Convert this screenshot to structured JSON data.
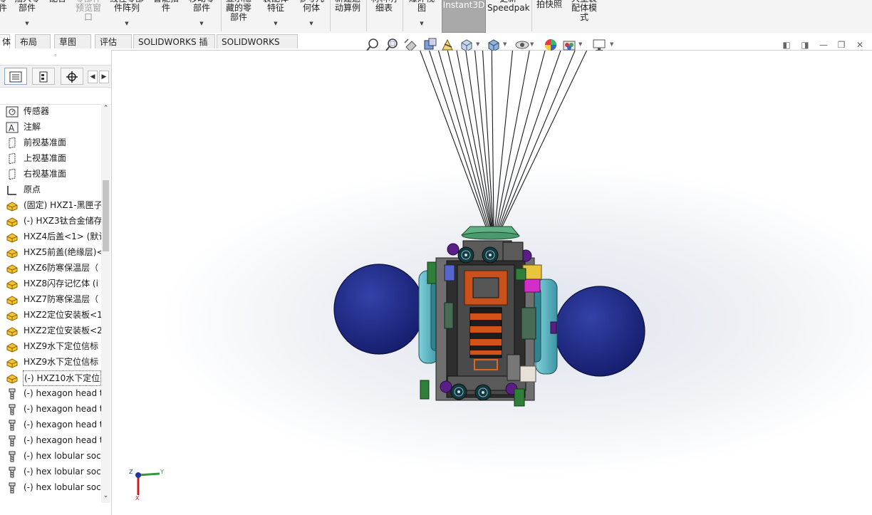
{
  "ribbon": {
    "buttons": [
      {
        "id": "rb-a",
        "label": "零\n件",
        "icon": "part-icon"
      },
      {
        "id": "rb-b",
        "label": "插入零\n部件",
        "icon": "insert-component-icon"
      },
      {
        "id": "rb-c",
        "label": "配合",
        "icon": "mate-icon"
      },
      {
        "id": "rb-d",
        "label": "零部件\n预览窗\n口",
        "icon": "preview-icon"
      },
      {
        "id": "rb-e",
        "label": "线性零部\n件阵列",
        "icon": "pattern-icon"
      },
      {
        "id": "rb-f",
        "label": "智能扣\n件",
        "icon": "smart-fastener-icon"
      },
      {
        "id": "rb-g",
        "label": "移动零\n部件",
        "icon": "move-component-icon"
      },
      {
        "id": "rb-h",
        "label": "显示隐\n藏的零\n部件",
        "icon": "show-hidden-icon"
      },
      {
        "id": "rb-i",
        "label": "装配体\n特征",
        "icon": "assembly-feature-icon"
      },
      {
        "id": "rb-j",
        "label": "参考几\n何体",
        "icon": "reference-geometry-icon"
      },
      {
        "id": "rb-k",
        "label": "新建运\n动算例",
        "icon": "motion-study-icon"
      },
      {
        "id": "rb-l",
        "label": "材料明\n细表",
        "icon": "bom-icon"
      },
      {
        "id": "rb-m",
        "label": "爆炸视\n图",
        "icon": "exploded-view-icon"
      },
      {
        "id": "rb-n",
        "label": "Instant3D",
        "icon": "instant3d-icon"
      },
      {
        "id": "rb-o",
        "label": "更新\nSpeedpak",
        "icon": "speedpak-icon"
      },
      {
        "id": "rb-p",
        "label": "拍快照",
        "icon": "snapshot-icon"
      },
      {
        "id": "rb-q",
        "label": "大型装\n配体模\n式",
        "icon": "large-assembly-icon"
      }
    ]
  },
  "tabs": [
    "体",
    "布局",
    "草图",
    "评估",
    "SOLIDWORKS 插件",
    "SOLIDWORKS MBD"
  ],
  "panel": {
    "grip": "◦",
    "tree": [
      {
        "label": "传感器",
        "icon": "sensor-icon"
      },
      {
        "label": "注解",
        "icon": "annotation-icon"
      },
      {
        "label": "前视基准面",
        "icon": "plane-icon"
      },
      {
        "label": "上视基准面",
        "icon": "plane-icon"
      },
      {
        "label": "右视基准面",
        "icon": "plane-icon"
      },
      {
        "label": "原点",
        "icon": "origin-icon"
      },
      {
        "label": "(固定) HXZ1-黑匣子",
        "icon": "part-icon"
      },
      {
        "label": "(-) HXZ3钛合金储存",
        "icon": "part-icon"
      },
      {
        "label": "HXZ4后盖<1> (默认",
        "icon": "part-icon"
      },
      {
        "label": "HXZ5前盖(绝缘层)<",
        "icon": "part-icon"
      },
      {
        "label": "HXZ6防寒保温层（",
        "icon": "part-icon"
      },
      {
        "label": "HXZ8闪存记忆体 (i",
        "icon": "part-icon"
      },
      {
        "label": "HXZ7防寒保温层（",
        "icon": "part-icon"
      },
      {
        "label": "HXZ2定位安装板<1",
        "icon": "part-icon"
      },
      {
        "label": "HXZ2定位安装板<2",
        "icon": "part-icon"
      },
      {
        "label": "HXZ9水下定位信标",
        "icon": "part-icon"
      },
      {
        "label": "HXZ9水下定位信标",
        "icon": "part-icon"
      },
      {
        "label": "(-) HXZ10水下定位",
        "icon": "part-icon"
      },
      {
        "label": "(-) hexagon head t",
        "icon": "screw-icon"
      },
      {
        "label": "(-) hexagon head t",
        "icon": "screw-icon"
      },
      {
        "label": "(-) hexagon head t",
        "icon": "screw-icon"
      },
      {
        "label": "(-) hexagon head t",
        "icon": "screw-icon"
      },
      {
        "label": "(-) hex lobular socl",
        "icon": "screw-icon"
      },
      {
        "label": "(-) hex lobular socl",
        "icon": "screw-icon"
      },
      {
        "label": "(-) hex lobular socl",
        "icon": "screw-icon"
      }
    ],
    "selected_index": 17
  },
  "triad": {
    "x": "X",
    "y": "Y",
    "z": "Z"
  },
  "colors": {
    "sphere": "#232e8c",
    "cone": "#5fb082",
    "float": "#5fb6c2",
    "body": "#3a3a3a",
    "orange": "#c8511c",
    "purple": "#5a1f86",
    "green": "#2f7f3b",
    "yellow": "#e8c53b",
    "magenta": "#d22ec8"
  }
}
